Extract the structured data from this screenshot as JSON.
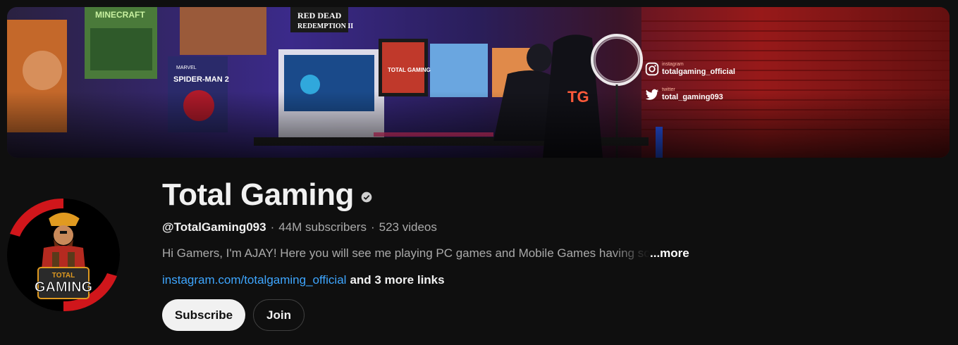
{
  "banner": {
    "posters": [
      "MINECRAFT",
      "RED DEAD",
      "REDEMPTION II",
      "MARVEL",
      "SPIDER-MAN 2"
    ],
    "chair_logo": "TG",
    "monitor_logo": "TOTAL GAMING",
    "instagram": {
      "kind": "instagram",
      "handle": "totalgaming_official"
    },
    "twitter": {
      "kind": "twitter",
      "handle": "total_gaming093"
    }
  },
  "avatar": {
    "logo_line1": "TOTAL",
    "logo_line2": "GAMING"
  },
  "channel": {
    "name": "Total Gaming",
    "handle": "@TotalGaming093",
    "subscribers": "44M subscribers",
    "videos": "523 videos",
    "separator": "·",
    "description": "Hi Gamers,  I'm AJAY! Here you will see me playing PC games and Mobile Games having so much fun",
    "more_label": "...more",
    "link": "instagram.com/totalgaming_official",
    "extra_links": "and 3 more links"
  },
  "actions": {
    "subscribe_label": "Subscribe",
    "join_label": "Join"
  },
  "colors": {
    "background": "#0f0f0f",
    "link": "#3ea6ff",
    "accent_red": "#d0161b"
  }
}
